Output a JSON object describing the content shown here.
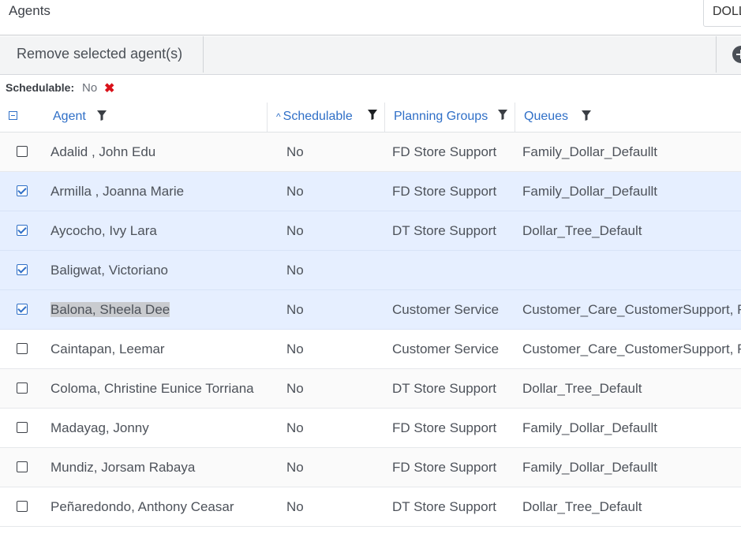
{
  "header": {
    "title": "Agents",
    "dropdown_value": "DOLL"
  },
  "toolbar": {
    "remove_label": "Remove selected agent(s)",
    "add_icon": "plus-circle-icon"
  },
  "filter": {
    "label": "Schedulable:",
    "value": "No",
    "remove_glyph": "✖"
  },
  "columns": {
    "agent": "Agent",
    "schedulable": "Schedulable",
    "planning_groups": "Planning Groups",
    "queues": "Queues",
    "sort_glyph": "^"
  },
  "colors": {
    "accent": "#2f6fc7",
    "selected_row": "#e6efff",
    "remove_red": "#d9121a"
  },
  "rows": [
    {
      "checked": false,
      "agent": "Adalid , John Edu",
      "schedulable": "No",
      "planning_group": "FD Store Support",
      "queues": "Family_Dollar_Defaullt"
    },
    {
      "checked": true,
      "agent": "Armilla , Joanna Marie",
      "schedulable": "No",
      "planning_group": "FD Store Support",
      "queues": "Family_Dollar_Defaullt"
    },
    {
      "checked": true,
      "agent": "Aycocho, Ivy Lara",
      "schedulable": "No",
      "planning_group": "DT Store Support",
      "queues": "Dollar_Tree_Default"
    },
    {
      "checked": true,
      "agent": "Baligwat, Victoriano",
      "schedulable": "No",
      "planning_group": "",
      "queues": ""
    },
    {
      "checked": true,
      "agent": "Balona, Sheela Dee",
      "schedulable": "No",
      "planning_group": "Customer Service",
      "queues": "Customer_Care_CustomerSupport, F",
      "highlight": true
    },
    {
      "checked": false,
      "agent": "Caintapan, Leemar",
      "schedulable": "No",
      "planning_group": "Customer Service",
      "queues": "Customer_Care_CustomerSupport, F"
    },
    {
      "checked": false,
      "agent": "Coloma, Christine Eunice Torriana",
      "schedulable": "No",
      "planning_group": "DT Store Support",
      "queues": "Dollar_Tree_Default"
    },
    {
      "checked": false,
      "agent": "Madayag, Jonny",
      "schedulable": "No",
      "planning_group": "FD Store Support",
      "queues": "Family_Dollar_Defaullt"
    },
    {
      "checked": false,
      "agent": "Mundiz, Jorsam Rabaya",
      "schedulable": "No",
      "planning_group": "FD Store Support",
      "queues": "Family_Dollar_Defaullt"
    },
    {
      "checked": false,
      "agent": "Peñaredondo, Anthony Ceasar",
      "schedulable": "No",
      "planning_group": "DT Store Support",
      "queues": "Dollar_Tree_Default"
    }
  ]
}
